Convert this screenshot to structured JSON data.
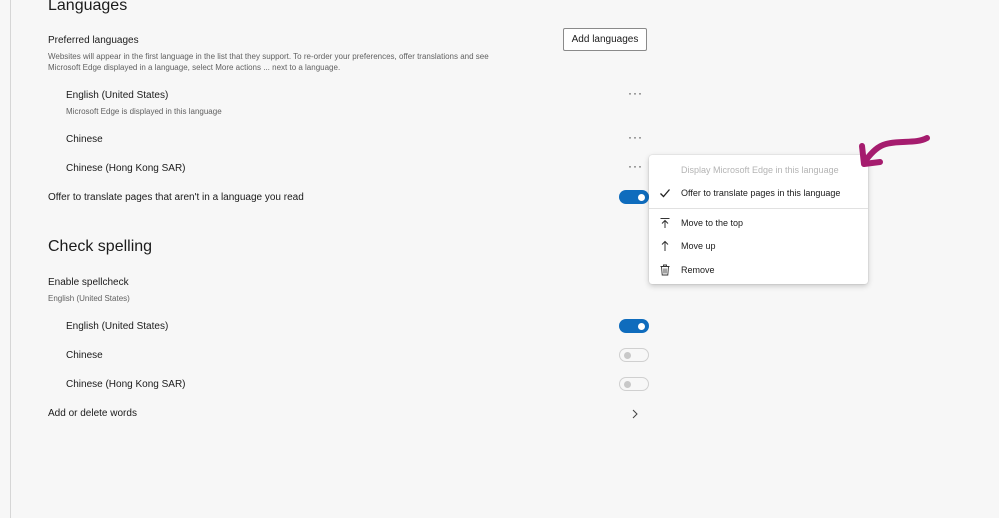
{
  "languages": {
    "heading": "Languages",
    "preferred_title": "Preferred languages",
    "preferred_desc_line1": "Websites will appear in the first language in the list that they support. To re-order your preferences, offer translations and see",
    "preferred_desc_line2": "Microsoft Edge displayed in a language, select More actions ... next to a language.",
    "add_button": "Add languages",
    "items": [
      {
        "name": "English (United States)",
        "note": "Microsoft Edge is displayed in this language"
      },
      {
        "name": "Chinese"
      },
      {
        "name": "Chinese (Hong Kong SAR)"
      }
    ],
    "more_actions": "···",
    "offer_translate_label": "Offer to translate pages that aren't in a language you read",
    "offer_translate_on": true
  },
  "context_menu": {
    "items": [
      {
        "label": "Display Microsoft Edge in this language",
        "disabled": true,
        "icon": ""
      },
      {
        "label": "Offer to translate pages in this language",
        "checked": true,
        "icon": "checkmark-icon"
      },
      {
        "label": "Move to the top",
        "icon": "move-to-top-icon"
      },
      {
        "label": "Move up",
        "icon": "arrow-up-icon"
      },
      {
        "label": "Remove",
        "icon": "trash-icon"
      }
    ]
  },
  "spelling": {
    "heading": "Check spelling",
    "enable_title": "Enable spellcheck",
    "enable_sub": "English (United States)",
    "items": [
      {
        "name": "English (United States)",
        "on": true
      },
      {
        "name": "Chinese",
        "on": false
      },
      {
        "name": "Chinese (Hong Kong SAR)",
        "on": false
      }
    ],
    "add_delete_words": "Add or delete words"
  },
  "colors": {
    "toggle_on": "#0f6cbd",
    "annotation_arrow": "#a51c6e"
  }
}
